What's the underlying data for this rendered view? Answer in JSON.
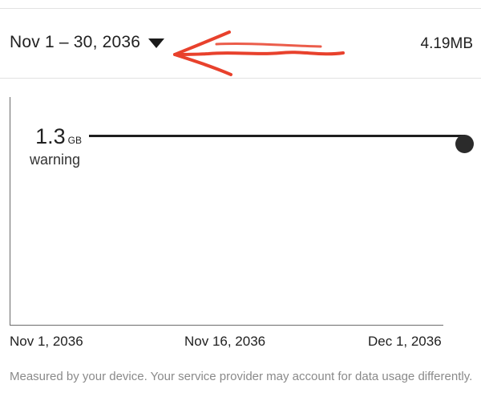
{
  "cycle": {
    "label": "Nov 1 – 30, 2036",
    "total_usage": "4.19MB"
  },
  "warning": {
    "value": "1.3",
    "unit": "GB",
    "label": "warning"
  },
  "x_axis": {
    "start": "Nov 1, 2036",
    "mid": "Nov 16, 2036",
    "end": "Dec 1, 2036"
  },
  "footer": {
    "note": "Measured by your device. Your service provider may account for data usage differently."
  },
  "colors": {
    "annotation_arrow": "#e8412c",
    "divider": "#e2e2e2",
    "footer_text": "#8a8a8a"
  },
  "icons": {
    "dropdown": "triangle-down",
    "annotation": "red-arrow-left"
  }
}
